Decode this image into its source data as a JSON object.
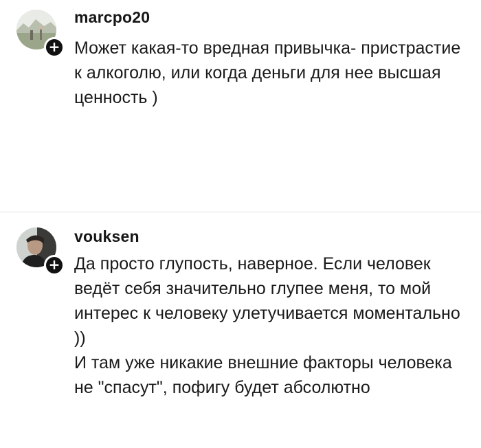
{
  "comments": [
    {
      "username": "marcpo20",
      "avatar_icon": "landscape-photo-avatar",
      "follow_icon": "plus-icon",
      "follow_glyph": "+",
      "paragraphs": [
        "Может какая-то вредная привычка- пристрастие к алкоголю, или когда деньги для нее высшая ценность )"
      ]
    },
    {
      "username": "vouksen",
      "avatar_icon": "portrait-photo-avatar",
      "follow_icon": "plus-icon",
      "follow_glyph": "+",
      "paragraphs": [
        "Да просто глупость, наверное. Если человек ведёт себя значительно глупее меня, то мой интерес к человеку улетучивается моментально ))",
        "И там уже никакие внешние факторы человека не \"спасут\", пофигу будет абсолютно"
      ]
    }
  ]
}
